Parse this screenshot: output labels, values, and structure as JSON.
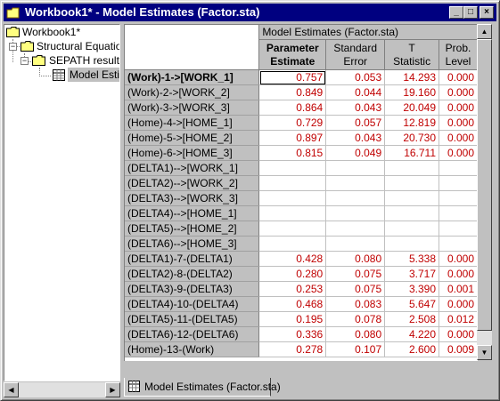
{
  "window": {
    "title": "Workbook1* - Model Estimates (Factor.sta)"
  },
  "tree": {
    "items": [
      {
        "label": "Workbook1*"
      },
      {
        "label": "Structural Equation"
      },
      {
        "label": "SEPATH result"
      },
      {
        "label": "Model Esti"
      }
    ]
  },
  "grid": {
    "caption": "Model Estimates (Factor.sta)",
    "columns": [
      {
        "line1": "Parameter",
        "line2": "Estimate"
      },
      {
        "line1": "Standard",
        "line2": "Error"
      },
      {
        "line1": "T",
        "line2": "Statistic"
      },
      {
        "line1": "Prob.",
        "line2": "Level"
      }
    ],
    "rows": [
      {
        "label": "(Work)-1->[WORK_1]",
        "values": [
          "0.757",
          "0.053",
          "14.293",
          "0.000"
        ]
      },
      {
        "label": "(Work)-2->[WORK_2]",
        "values": [
          "0.849",
          "0.044",
          "19.160",
          "0.000"
        ]
      },
      {
        "label": "(Work)-3->[WORK_3]",
        "values": [
          "0.864",
          "0.043",
          "20.049",
          "0.000"
        ]
      },
      {
        "label": "(Home)-4->[HOME_1]",
        "values": [
          "0.729",
          "0.057",
          "12.819",
          "0.000"
        ]
      },
      {
        "label": "(Home)-5->[HOME_2]",
        "values": [
          "0.897",
          "0.043",
          "20.730",
          "0.000"
        ]
      },
      {
        "label": "(Home)-6->[HOME_3]",
        "values": [
          "0.815",
          "0.049",
          "16.711",
          "0.000"
        ]
      },
      {
        "label": "(DELTA1)-->[WORK_1]",
        "values": [
          "",
          "",
          "",
          ""
        ]
      },
      {
        "label": "(DELTA2)-->[WORK_2]",
        "values": [
          "",
          "",
          "",
          ""
        ]
      },
      {
        "label": "(DELTA3)-->[WORK_3]",
        "values": [
          "",
          "",
          "",
          ""
        ]
      },
      {
        "label": "(DELTA4)-->[HOME_1]",
        "values": [
          "",
          "",
          "",
          ""
        ]
      },
      {
        "label": "(DELTA5)-->[HOME_2]",
        "values": [
          "",
          "",
          "",
          ""
        ]
      },
      {
        "label": "(DELTA6)-->[HOME_3]",
        "values": [
          "",
          "",
          "",
          ""
        ]
      },
      {
        "label": "(DELTA1)-7-(DELTA1)",
        "values": [
          "0.428",
          "0.080",
          "5.338",
          "0.000"
        ]
      },
      {
        "label": "(DELTA2)-8-(DELTA2)",
        "values": [
          "0.280",
          "0.075",
          "3.717",
          "0.000"
        ]
      },
      {
        "label": "(DELTA3)-9-(DELTA3)",
        "values": [
          "0.253",
          "0.075",
          "3.390",
          "0.001"
        ]
      },
      {
        "label": "(DELTA4)-10-(DELTA4)",
        "values": [
          "0.468",
          "0.083",
          "5.647",
          "0.000"
        ]
      },
      {
        "label": "(DELTA5)-11-(DELTA5)",
        "values": [
          "0.195",
          "0.078",
          "2.508",
          "0.012"
        ]
      },
      {
        "label": "(DELTA6)-12-(DELTA6)",
        "values": [
          "0.336",
          "0.080",
          "4.220",
          "0.000"
        ]
      },
      {
        "label": "(Home)-13-(Work)",
        "values": [
          "0.278",
          "0.107",
          "2.600",
          "0.009"
        ]
      }
    ]
  },
  "tab": {
    "label": "Model Estimates (Factor.sta)"
  },
  "icons": {
    "app": "workbook-icon",
    "minimize": "minimize-icon",
    "maximize": "maximize-icon",
    "close": "close-icon",
    "folder": "folder-icon",
    "spreadsheet": "spreadsheet-icon"
  },
  "colors": {
    "titlebar": "#000080",
    "values": "#c00000",
    "chrome": "#c0c0c0"
  }
}
